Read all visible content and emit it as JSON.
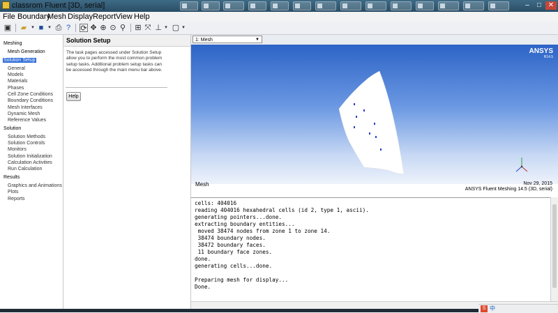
{
  "window": {
    "title": "classrom Fluent  [3D, serial]",
    "controls": {
      "minimize": "–",
      "maximize": "□",
      "close": "✕"
    }
  },
  "menubar": [
    "File",
    "Boundary",
    "Mesh",
    "Display",
    "Report",
    "View",
    "Help"
  ],
  "toolbar": {
    "icons": [
      "read-case-icon",
      "open-folder-icon",
      "save-icon",
      "print-icon",
      "help-icon",
      "rotate-icon",
      "pan-icon",
      "zoom-in-icon",
      "zoom-to-fit-icon",
      "probe-icon",
      "zoom-box-icon",
      "fit-icon",
      "axes-icon",
      "layout-icon"
    ]
  },
  "tree": {
    "meshing_header": "Meshing",
    "meshing_items": [
      "Mesh Generation"
    ],
    "solution_setup": "Solution Setup",
    "setup_items": [
      "General",
      "Models",
      "Materials",
      "Phases",
      "Cell Zone Conditions",
      "Boundary Conditions",
      "Mesh Interfaces",
      "Dynamic Mesh",
      "Reference Values"
    ],
    "solution_header": "Solution",
    "solution_items": [
      "Solution Methods",
      "Solution Controls",
      "Monitors",
      "Solution Initialization",
      "Calculation Activities",
      "Run Calculation"
    ],
    "results_header": "Results",
    "results_items": [
      "Graphics and Animations",
      "Plots",
      "Reports"
    ]
  },
  "task_page": {
    "title": "Solution Setup",
    "description": "The task pages accessed under Solution Setup allow you to perform the most common problem setup tasks. Additional problem setup tasks can be accessed through the main menu bar above.",
    "help_button": "Help"
  },
  "graphics": {
    "window_selector": "1: Mesh",
    "logo": "ANSYS",
    "logo_version": "R14.5",
    "label": "Mesh",
    "date": "Nov 29, 2015",
    "product": "ANSYS Fluent Meshing 14.5 (3D, serial)",
    "colors": {
      "viewport_top": "#2d64c6",
      "viewport_bottom": "#eef3fb",
      "mesh_surface": "#ffffff"
    }
  },
  "console": {
    "lines": [
      "cells: 404016",
      "reading 404016 hexahedral cells (id 2, type 1, ascii).",
      "generating pointers...done.",
      "extracting boundary entities...",
      " moved 38474 nodes from zone 1 to zone 14.",
      " 38474 boundary nodes.",
      " 38472 boundary faces.",
      " 11 boundary face zones.",
      "done.",
      "generating cells...done.",
      "",
      "Preparing mesh for display...",
      "Done."
    ]
  },
  "tray": {
    "input_method": "中"
  }
}
